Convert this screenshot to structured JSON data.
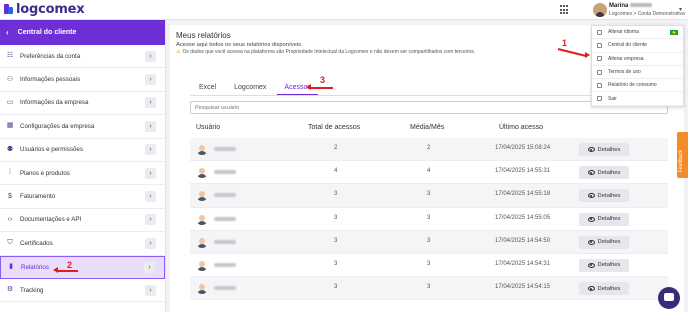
{
  "brand": {
    "name": "logcomex"
  },
  "user": {
    "first_name": "Marina",
    "account": "Logcomex > Conta Demonstrativa"
  },
  "sidebar": {
    "title": "Central do cliente",
    "items": [
      {
        "label": "Preferências da conta",
        "icon": "sliders-icon"
      },
      {
        "label": "Informações pessoais",
        "icon": "person-icon"
      },
      {
        "label": "Informações da empresa",
        "icon": "briefcase-icon"
      },
      {
        "label": "Configurações da empresa",
        "icon": "building-icon"
      },
      {
        "label": "Usuários e permissões",
        "icon": "users-icon"
      },
      {
        "label": "Planos e produtos",
        "icon": "grid-icon"
      },
      {
        "label": "Faturamento",
        "icon": "dollar-icon"
      },
      {
        "label": "Documentações e API",
        "icon": "code-icon"
      },
      {
        "label": "Certificados",
        "icon": "shield-icon"
      },
      {
        "label": "Relatórios",
        "icon": "bar-chart-icon",
        "active": true
      },
      {
        "label": "Tracking",
        "icon": "gear-icon"
      }
    ]
  },
  "main": {
    "title": "Meus relatórios",
    "subtitle": "Acesse aqui todos os seus relatórios disponíveis.",
    "warning": "Os dados que você acessa na plataforma são Propriedade Intelectual da Logcomex e não devem ser compartilhados com terceiros.",
    "tabs": [
      "Excel",
      "Logcomex",
      "Acessos"
    ],
    "active_tab": "Acessos",
    "search_placeholder": "Pesquisar usuário"
  },
  "table": {
    "headers": [
      "Usuário",
      "Total de acessos",
      "Média/Mês",
      "Último acesso"
    ],
    "rows": [
      {
        "total": "2",
        "media": "2",
        "ultimo": "17/04/2025 15:08:24",
        "action": "Detalhes"
      },
      {
        "total": "4",
        "media": "4",
        "ultimo": "17/04/2025 14:55:31",
        "action": "Detalhes"
      },
      {
        "total": "3",
        "media": "3",
        "ultimo": "17/04/2025 14:55:18",
        "action": "Detalhes"
      },
      {
        "total": "3",
        "media": "3",
        "ultimo": "17/04/2025 14:55:05",
        "action": "Detalhes"
      },
      {
        "total": "3",
        "media": "3",
        "ultimo": "17/04/2025 14:54:50",
        "action": "Detalhes"
      },
      {
        "total": "3",
        "media": "3",
        "ultimo": "17/04/2025 14:54:31",
        "action": "Detalhes"
      },
      {
        "total": "3",
        "media": "3",
        "ultimo": "17/04/2025 14:54:15",
        "action": "Detalhes"
      }
    ]
  },
  "dropdown": {
    "items": [
      "Alterar idioma",
      "Central do cliente",
      "Alterar empresa",
      "Termos de uso",
      "Relatório de consumo",
      "Sair"
    ]
  },
  "feedback": {
    "label": "Feedback"
  },
  "annotations": {
    "n1": "1",
    "n2": "2",
    "n3": "3"
  },
  "colors": {
    "primary": "#6f2fd6",
    "annotation": "#e11d1d",
    "feedback": "#f28c28"
  }
}
